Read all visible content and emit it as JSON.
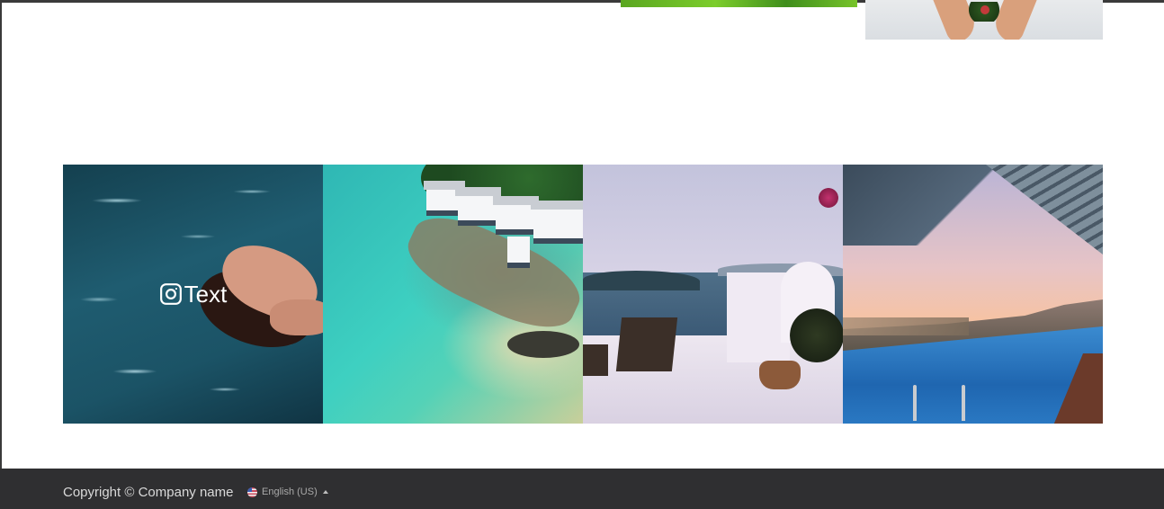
{
  "gallery": {
    "items": [
      {
        "overlay_text": "Text",
        "icon": "instagram-icon"
      },
      {
        "overlay_text": ""
      },
      {
        "overlay_text": ""
      },
      {
        "overlay_text": ""
      }
    ]
  },
  "footer": {
    "copyright": "Copyright © Company name",
    "language": "English (US)",
    "language_icon": "us-flag-icon",
    "caret_icon": "caret-up-icon"
  },
  "colors": {
    "footer_bg": "#2f2f31",
    "footer_text": "#d9d9d9"
  }
}
